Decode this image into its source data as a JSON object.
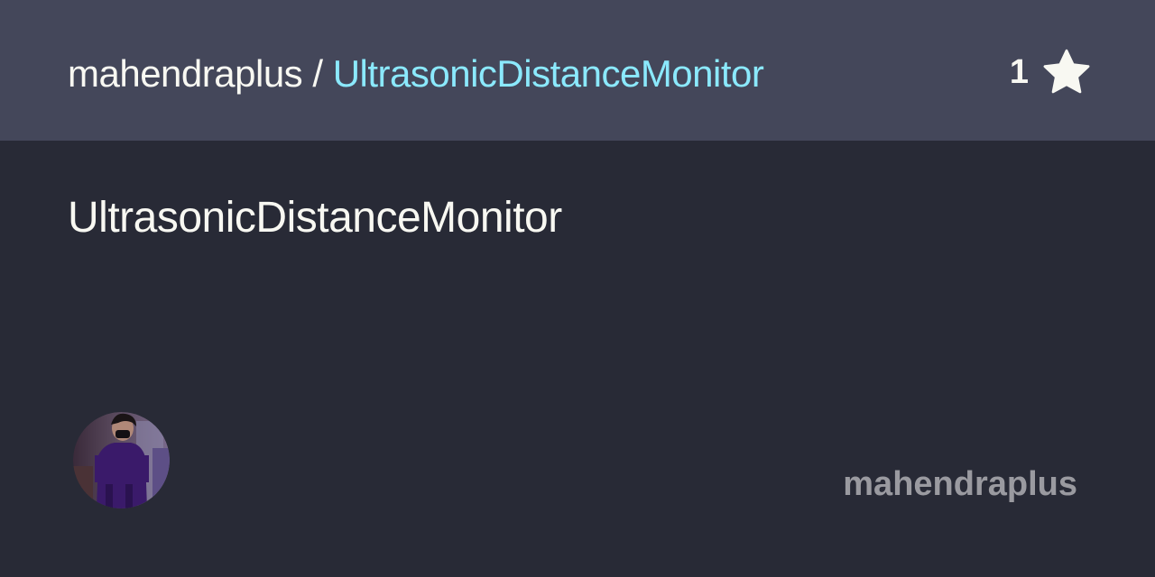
{
  "header": {
    "owner": "mahendraplus",
    "separator": "/",
    "repo": "UltrasonicDistanceMonitor",
    "star_count": "1",
    "star_icon": "star-icon"
  },
  "main": {
    "description": "UltrasonicDistanceMonitor"
  },
  "footer": {
    "avatar_icon": "user-avatar",
    "username": "mahendraplus"
  },
  "colors": {
    "header_bg": "#44475a",
    "body_bg": "#282a36",
    "text": "#f8f8f2",
    "repo_link": "#8be9fd",
    "username": "#9a9aa0"
  }
}
